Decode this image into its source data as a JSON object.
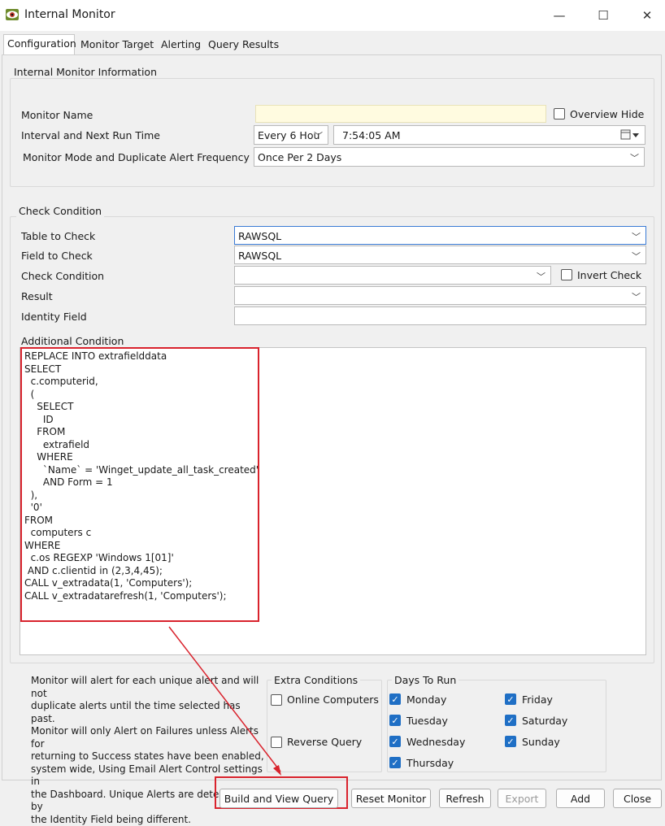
{
  "window": {
    "title": "Internal Monitor",
    "minimize": "—",
    "maximize": "☐",
    "close": "✕"
  },
  "tabs": [
    {
      "label": "Configuration"
    },
    {
      "label": "Monitor Target"
    },
    {
      "label": "Alerting"
    },
    {
      "label": "Query Results"
    }
  ],
  "info": {
    "group_label": "Internal Monitor Information",
    "monitor_name_label": "Monitor Name",
    "monitor_name_value": "",
    "overview_hide_label": "Overview Hide",
    "interval_label": "Interval and Next Run Time",
    "interval_value": "Every 6 Hou",
    "next_run_value": "7:54:05 AM",
    "mode_label": "Monitor Mode and Duplicate Alert Frequency",
    "mode_value": "Once Per 2 Days"
  },
  "check": {
    "group_label": "Check Condition",
    "table_label": "Table to Check",
    "table_value": "RAWSQL",
    "field_label": "Field to Check",
    "field_value": "RAWSQL",
    "condition_label": "Check Condition",
    "condition_value": "",
    "invert_label": "Invert Check",
    "result_label": "Result",
    "result_value": "",
    "identity_label": "Identity Field",
    "identity_value": "",
    "additional_label": "Additional Condition",
    "sql_lines": [
      "REPLACE INTO extrafielddata",
      "SELECT",
      "  c.computerid,",
      "  (",
      "    SELECT",
      "      ID",
      "    FROM",
      "      extrafield",
      "    WHERE",
      "      `Name` = 'Winget_update_all_task_created'",
      "      AND Form = 1",
      "  ),",
      "  '0'",
      "FROM",
      "  computers c",
      "WHERE",
      "  c.os REGEXP 'Windows 1[01]'",
      " AND c.clientid in (2,3,4,45);",
      "CALL v_extradata(1, 'Computers');",
      "CALL v_extradatarefresh(1, 'Computers');"
    ]
  },
  "notice": {
    "lines": [
      "Monitor will alert for each unique alert and will not",
      "duplicate alerts until the time selected has past.",
      "Monitor will only Alert on Failures unless Alerts for",
      "returning to Success states have been enabled,",
      "system wide, Using Email Alert Control settings in",
      "the Dashboard. Unique Alerts are determined by",
      "the Identity Field being different."
    ]
  },
  "extra": {
    "group_label": "Extra Conditions",
    "online_label": "Online Computers",
    "online_checked": false,
    "reverse_label": "Reverse Query",
    "reverse_checked": false
  },
  "days": {
    "group_label": "Days To Run",
    "items": [
      {
        "label": "Monday",
        "checked": true
      },
      {
        "label": "Tuesday",
        "checked": true
      },
      {
        "label": "Wednesday",
        "checked": true
      },
      {
        "label": "Thursday",
        "checked": true
      },
      {
        "label": "Friday",
        "checked": true
      },
      {
        "label": "Saturday",
        "checked": true
      },
      {
        "label": "Sunday",
        "checked": true
      }
    ]
  },
  "buttons": {
    "build": "Build and View Query",
    "reset": "Reset Monitor",
    "refresh": "Refresh",
    "export": "Export",
    "add": "Add",
    "close": "Close"
  },
  "colors": {
    "highlight_red": "#d9232d",
    "checkbox_blue": "#1f6fc5",
    "name_field_bg": "#fffbe0"
  }
}
